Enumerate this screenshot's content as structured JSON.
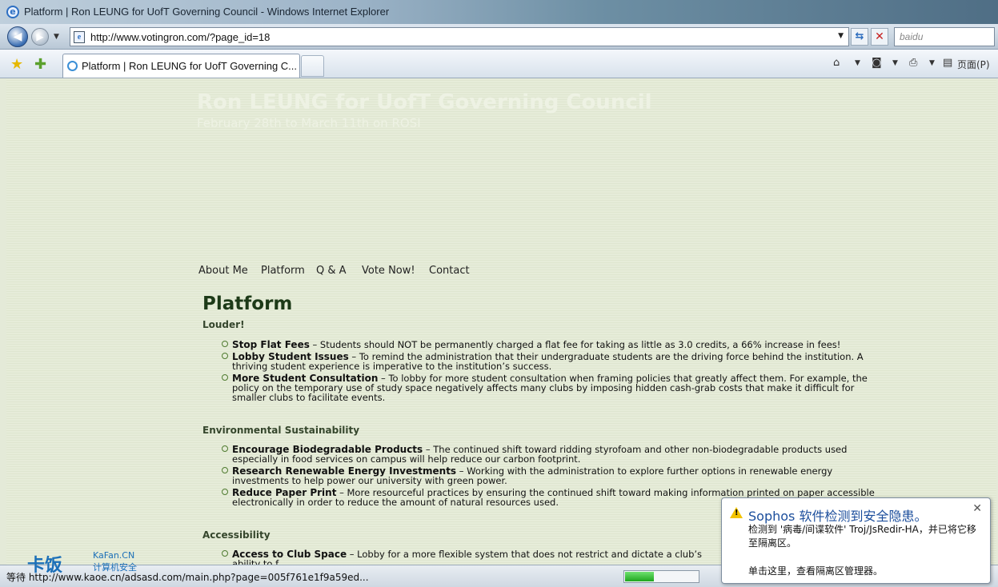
{
  "window": {
    "title": "Platform | Ron LEUNG for UofT Governing Council - Windows Internet Explorer"
  },
  "address": {
    "url": "http://www.votingron.com/?page_id=18"
  },
  "search": {
    "placeholder": "baidu"
  },
  "tab": {
    "label": "Platform | Ron LEUNG for UofT Governing C..."
  },
  "toolbar": {
    "page_label": "页面(P)"
  },
  "site": {
    "title": "Ron LEUNG for UofT Governing Council",
    "subtitle": "February 28th to March 11th on ROSI"
  },
  "menu": [
    "About Me",
    "Platform",
    "Q & A",
    "Vote Now!",
    "Contact"
  ],
  "page_title": "Platform",
  "sections": [
    {
      "heading": "Louder!",
      "items": [
        {
          "bold": "Stop Flat Fees",
          "text": " – Students should NOT be permanently charged a flat fee for taking as little as 3.0 credits, a 66% increase in fees!"
        },
        {
          "bold": "Lobby Student Issues",
          "text": " – To remind the administration that their undergraduate students are the driving force behind the institution. A thriving student experience is imperative to the institution’s success."
        },
        {
          "bold": "More Student Consultation",
          "text": " – To lobby for more student consultation when framing policies that greatly affect them. For example, the policy on the temporary use of study space negatively affects many clubs by imposing hidden cash-grab costs that make it difficult for smaller clubs to facilitate events."
        }
      ]
    },
    {
      "heading": "Environmental Sustainability",
      "items": [
        {
          "bold": "Encourage Biodegradable Products",
          "text": " – The continued shift toward ridding styrofoam and other non-biodegradable products used especially in food services on campus will help reduce our carbon footprint."
        },
        {
          "bold": "Research Renewable Energy Investments",
          "text": " – Working with the administration to explore further options in renewable energy investments to help power our university with green power."
        },
        {
          "bold": "Reduce Paper Print",
          "text": " – More resourceful practices by ensuring the continued shift toward making information printed on paper accessible electronically in order to reduce the amount of natural resources used."
        }
      ]
    },
    {
      "heading": "Accessibility",
      "items": [
        {
          "bold": "Access to Club Space",
          "text": " – Lobby for a more flexible system that does not restrict and dictate a club’s ability to f"
        }
      ]
    }
  ],
  "status": {
    "text": "等待 http://www.kaoe.cn/adsasd.com/main.php?page=005f761e1f9a59ed...",
    "progress": 0.4
  },
  "watermark": {
    "brand": "卡饭",
    "domain": "KaFan.CN",
    "tagline": "计算机安全"
  },
  "popup": {
    "title": "Sophos 软件检测到安全隐患。",
    "body": "检测到 '病毒/间谍软件' Troj/JsRedir-HA，并已将它移至隔离区。",
    "action": "单击这里，查看隔离区管理器。"
  },
  "colors": {
    "page_bg": "#e4ead8",
    "heading": "#1d3a18",
    "bullet": "#4f7b30",
    "popup_title": "#1c4e9c"
  }
}
